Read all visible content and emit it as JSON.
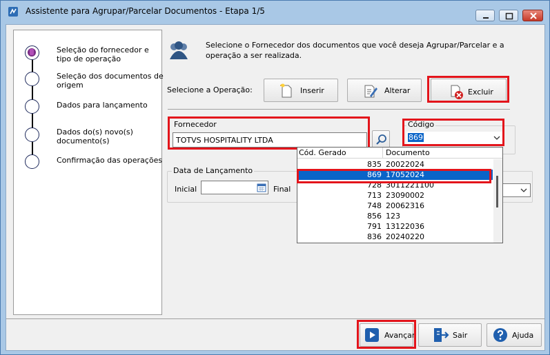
{
  "window": {
    "title": "Assistente para Agrupar/Parcelar Documentos - Etapa 1/5"
  },
  "steps": [
    {
      "label": "Seleção do fornecedor e tipo de operação",
      "active": true
    },
    {
      "label": "Seleção dos documentos de origem",
      "active": false
    },
    {
      "label": "Dados para lançamento",
      "active": false
    },
    {
      "label": "Dados do(s) novo(s) documento(s)",
      "active": false
    },
    {
      "label": "Confirmação das operações",
      "active": false
    }
  ],
  "header": {
    "description": "Selecione o Fornecedor dos documentos que você deseja Agrupar/Parcelar e a operação a ser realizada.",
    "icon": "users-icon"
  },
  "operation": {
    "label": "Selecione a Operação:",
    "buttons": [
      {
        "label": "Inserir",
        "icon": "insert-icon"
      },
      {
        "label": "Alterar",
        "icon": "edit-icon"
      },
      {
        "label": "Excluir",
        "icon": "delete-icon",
        "highlighted": true
      }
    ]
  },
  "fornecedor": {
    "group_label": "Fornecedor",
    "value": "TOTVS HOSPITALITY LTDA"
  },
  "codigo": {
    "group_label": "Código",
    "value": "869"
  },
  "data_lancamento": {
    "group_label": "Data de Lançamento",
    "inicial_label": "Inicial",
    "final_label": "Final",
    "inicial_value": ""
  },
  "dropdown": {
    "columns": [
      "Cód. Gerado",
      "Documento"
    ],
    "rows": [
      {
        "codigo": "835",
        "documento": "20022024",
        "selected": false
      },
      {
        "codigo": "869",
        "documento": "17052024",
        "selected": true
      },
      {
        "codigo": "728",
        "documento": "3011221100",
        "selected": false
      },
      {
        "codigo": "713",
        "documento": "23090002",
        "selected": false
      },
      {
        "codigo": "748",
        "documento": "20062316",
        "selected": false
      },
      {
        "codigo": "856",
        "documento": "123",
        "selected": false
      },
      {
        "codigo": "791",
        "documento": "13122036",
        "selected": false
      },
      {
        "codigo": "836",
        "documento": "20240220",
        "selected": false
      }
    ]
  },
  "footer": {
    "buttons": [
      {
        "label": "Avançar",
        "icon": "play-icon"
      },
      {
        "label": "Sair",
        "icon": "exit-icon"
      },
      {
        "label": "Ajuda",
        "icon": "help-icon"
      }
    ]
  },
  "colors": {
    "highlight": "#e3141b",
    "selection": "#0a64c8",
    "titlebar": "#a9c8e6"
  }
}
